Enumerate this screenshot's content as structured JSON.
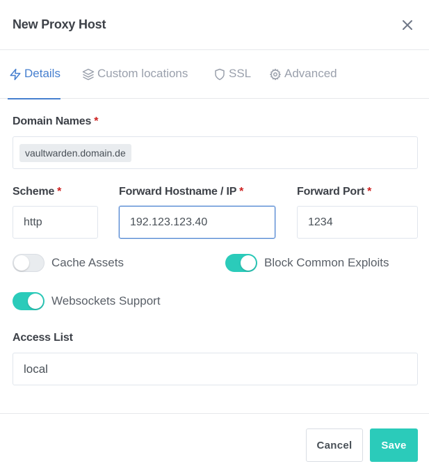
{
  "modal": {
    "title": "New Proxy Host",
    "close_icon": "close-icon"
  },
  "tabs": [
    {
      "label": "Details",
      "icon": "bolt-icon",
      "active": true
    },
    {
      "label": "Custom locations",
      "icon": "layers-icon",
      "active": false
    },
    {
      "label": "SSL",
      "icon": "shield-icon",
      "active": false
    },
    {
      "label": "Advanced",
      "icon": "gear-icon",
      "active": false
    }
  ],
  "form": {
    "domain_names": {
      "label": "Domain Names",
      "required_mark": "*",
      "values": [
        "vaultwarden.domain.de"
      ]
    },
    "scheme": {
      "label": "Scheme",
      "required_mark": "*",
      "value": "http"
    },
    "forward_host": {
      "label": "Forward Hostname / IP",
      "required_mark": "*",
      "value": "192.123.123.40"
    },
    "forward_port": {
      "label": "Forward Port",
      "required_mark": "*",
      "value": "1234"
    },
    "toggles": {
      "cache_assets": {
        "label": "Cache Assets",
        "checked": false
      },
      "block_exploits": {
        "label": "Block Common Exploits",
        "checked": true
      },
      "websockets": {
        "label": "Websockets Support",
        "checked": true
      }
    },
    "access_list": {
      "label": "Access List",
      "value": "local"
    }
  },
  "footer": {
    "cancel_label": "Cancel",
    "save_label": "Save"
  },
  "colors": {
    "accent_blue": "#467fcf",
    "teal": "#2bcbba",
    "required_red": "#cd201f"
  }
}
